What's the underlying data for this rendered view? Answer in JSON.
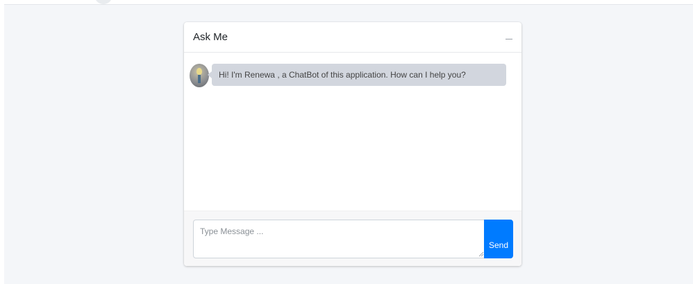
{
  "chat": {
    "title": "Ask Me",
    "collapse_icon": "minus-icon",
    "bot_avatar_icon": "lightbulb-avatar-icon",
    "messages": [
      {
        "sender": "bot",
        "text": "Hi! I'm Renewa , a ChatBot of this application. How can I help you?"
      }
    ],
    "input": {
      "placeholder": "Type Message ...",
      "value": ""
    },
    "send_label": "Send"
  },
  "colors": {
    "page_background": "#f4f6f9",
    "bubble_background": "#d2d6de",
    "send_button": "#007bff"
  }
}
